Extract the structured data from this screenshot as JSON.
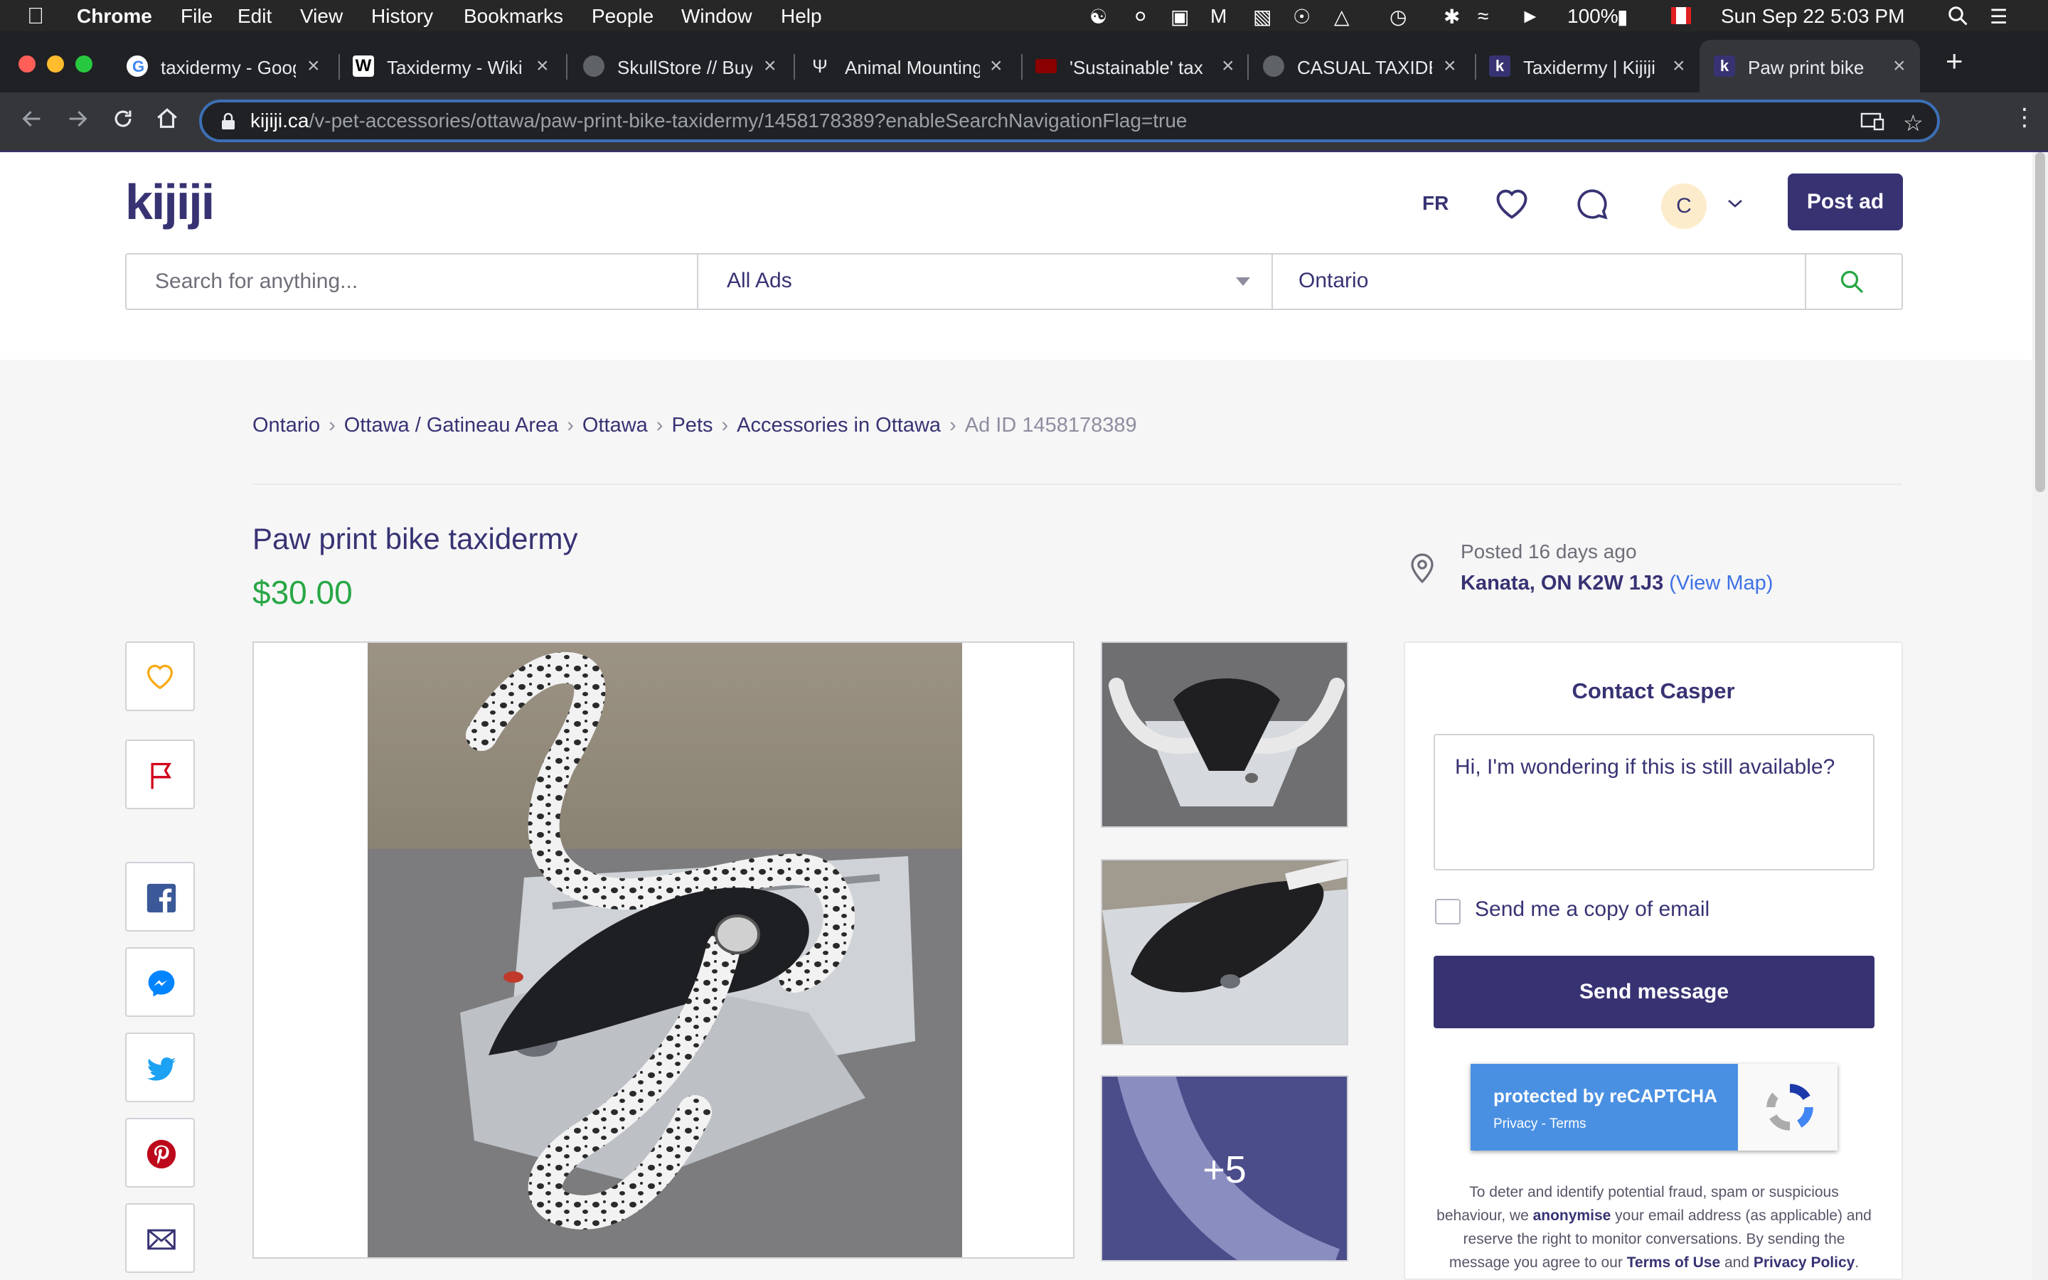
{
  "menubar": {
    "apple": "",
    "app": "Chrome",
    "menus": [
      "File",
      "Edit",
      "View",
      "History",
      "Bookmarks",
      "People",
      "Window",
      "Help"
    ],
    "battery": "100%",
    "clock": "Sun Sep 22  5:03 PM"
  },
  "tabs": [
    {
      "title": "taxidermy - Goog",
      "favicon": "google-icon"
    },
    {
      "title": "Taxidermy - Wiki",
      "favicon": "wikipedia-icon"
    },
    {
      "title": "SkullStore // Buy",
      "favicon": "globe-icon"
    },
    {
      "title": "Animal Mounting",
      "favicon": "antler-icon"
    },
    {
      "title": "'Sustainable' tax",
      "favicon": "now-icon"
    },
    {
      "title": "CASUAL TAXIDE",
      "favicon": "globe-icon"
    },
    {
      "title": "Taxidermy | Kijiji",
      "favicon": "kijiji-icon"
    },
    {
      "title": "Paw print bike ta",
      "favicon": "kijiji-icon"
    }
  ],
  "address": {
    "host": "kijiji.ca",
    "path": "/v-pet-accessories/ottawa/paw-print-bike-taxidermy/1458178389?enableSearchNavigationFlag=true"
  },
  "header": {
    "logo": "kijiji",
    "lang": "FR",
    "avatar_initial": "C",
    "post_ad": "Post ad"
  },
  "search": {
    "placeholder": "Search for anything...",
    "category": "All Ads",
    "location": "Ontario"
  },
  "breadcrumb": {
    "items": [
      "Ontario",
      "Ottawa / Gatineau Area",
      "Ottawa",
      "Pets",
      "Accessories in Ottawa"
    ],
    "ad_id": "Ad ID 1458178389"
  },
  "listing": {
    "title": "Paw print bike taxidermy",
    "price": "$30.00",
    "posted": "Posted 16 days ago",
    "location": "Kanata, ON K2W 1J3",
    "view_map": "(View Map)",
    "more_photos": "+5"
  },
  "contact": {
    "title": "Contact Casper",
    "message": "Hi, I'm wondering if this is still available?",
    "copy_label": "Send me a copy of email",
    "send": "Send message",
    "recaptcha_line1": "protected by reCAPTCHA",
    "recaptcha_line2": "Privacy - Terms",
    "fraud_1": "To deter and identify potential fraud, spam or suspicious behaviour, we ",
    "fraud_bold": "anonymise",
    "fraud_2": " your email address (as applicable) and reserve the right to monitor conversations. By sending the message you agree to our ",
    "terms": "Terms of Use",
    "fraud_and": " and ",
    "privacy": "Privacy Policy",
    "fraud_end": "."
  },
  "colors": {
    "brand": "#373373",
    "price": "#28a745",
    "link": "#3e71e5"
  }
}
